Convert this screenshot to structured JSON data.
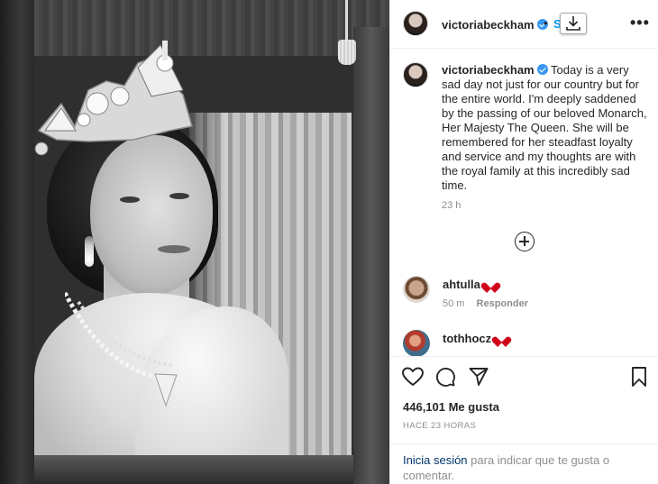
{
  "post": {
    "username": "victoriabeckham",
    "follow_label": "S",
    "dot": "•",
    "more_label": "•••",
    "caption_text": "Today is a very sad day not just for our country but for the entire world. I'm deeply saddened by the passing of our beloved Monarch, Her Majesty The Queen. She will be remembered for her steadfast loyalty and service and my thoughts are with the royal family at this incredibly sad time.",
    "caption_time": "23 h",
    "likes_label": "446,101 Me gusta",
    "posted_ago": "HACE 23 HORAS"
  },
  "comments": [
    {
      "username": "ahtulla",
      "time": "50 m",
      "reply_label": "Responder"
    },
    {
      "username": "tothhocz"
    }
  ],
  "login_prompt": {
    "link_label": "Inicia sesión",
    "rest": " para indicar que te gusta o comentar."
  },
  "icons": {
    "verified": "verified-badge-icon",
    "download": "download-icon",
    "more": "more-options-icon",
    "load_more": "plus-circle-icon",
    "like": "heart-outline-icon",
    "comment": "comment-icon",
    "share": "paper-plane-icon",
    "save": "bookmark-icon"
  },
  "colors": {
    "link_blue": "#0095f6",
    "verified_blue": "#3897f0",
    "heart_red": "#d0021b",
    "muted_text": "#8e8e8e"
  }
}
